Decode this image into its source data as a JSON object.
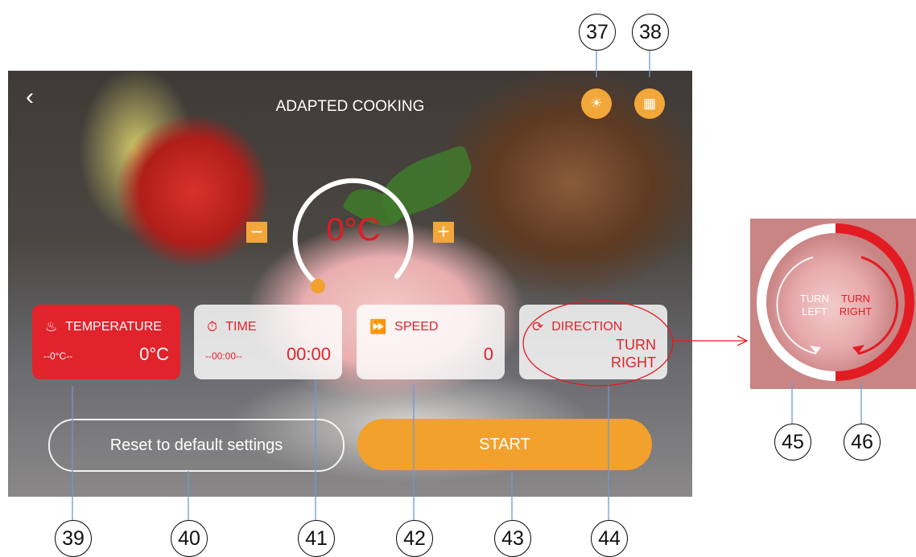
{
  "screen": {
    "title": "ADAPTED COOKING",
    "back_icon": "chevron-left-icon",
    "top_icons": [
      "sun-icon",
      "filter-icon"
    ],
    "dial": {
      "value": "0°C",
      "minus_label": "−",
      "plus_label": "+"
    },
    "cards": [
      {
        "label": "TEMPERATURE",
        "icon": "thermometer-icon",
        "sub": "--0°C--",
        "value": "0°C",
        "active": true
      },
      {
        "label": "TIME",
        "icon": "timer-icon",
        "sub": "--00:00--",
        "value": "00:00",
        "active": false
      },
      {
        "label": "SPEED",
        "icon": "fast-forward-icon",
        "value": "0",
        "active": false
      },
      {
        "label": "DIRECTION",
        "icon": "rotate-icon",
        "value_line1": "TURN",
        "value_line2": "RIGHT",
        "active": false
      }
    ],
    "reset_label": "Reset to default settings",
    "start_label": "START"
  },
  "inset": {
    "left_label_1": "TURN",
    "left_label_2": "LEFT",
    "right_label_1": "TURN",
    "right_label_2": "RIGHT"
  },
  "callouts": [
    "37",
    "38",
    "39",
    "40",
    "41",
    "42",
    "43",
    "44",
    "45",
    "46"
  ],
  "colors": {
    "accent_red": "#e1232c",
    "accent_orange": "#f2a12d",
    "annotation_blue": "#6b9ad6"
  }
}
